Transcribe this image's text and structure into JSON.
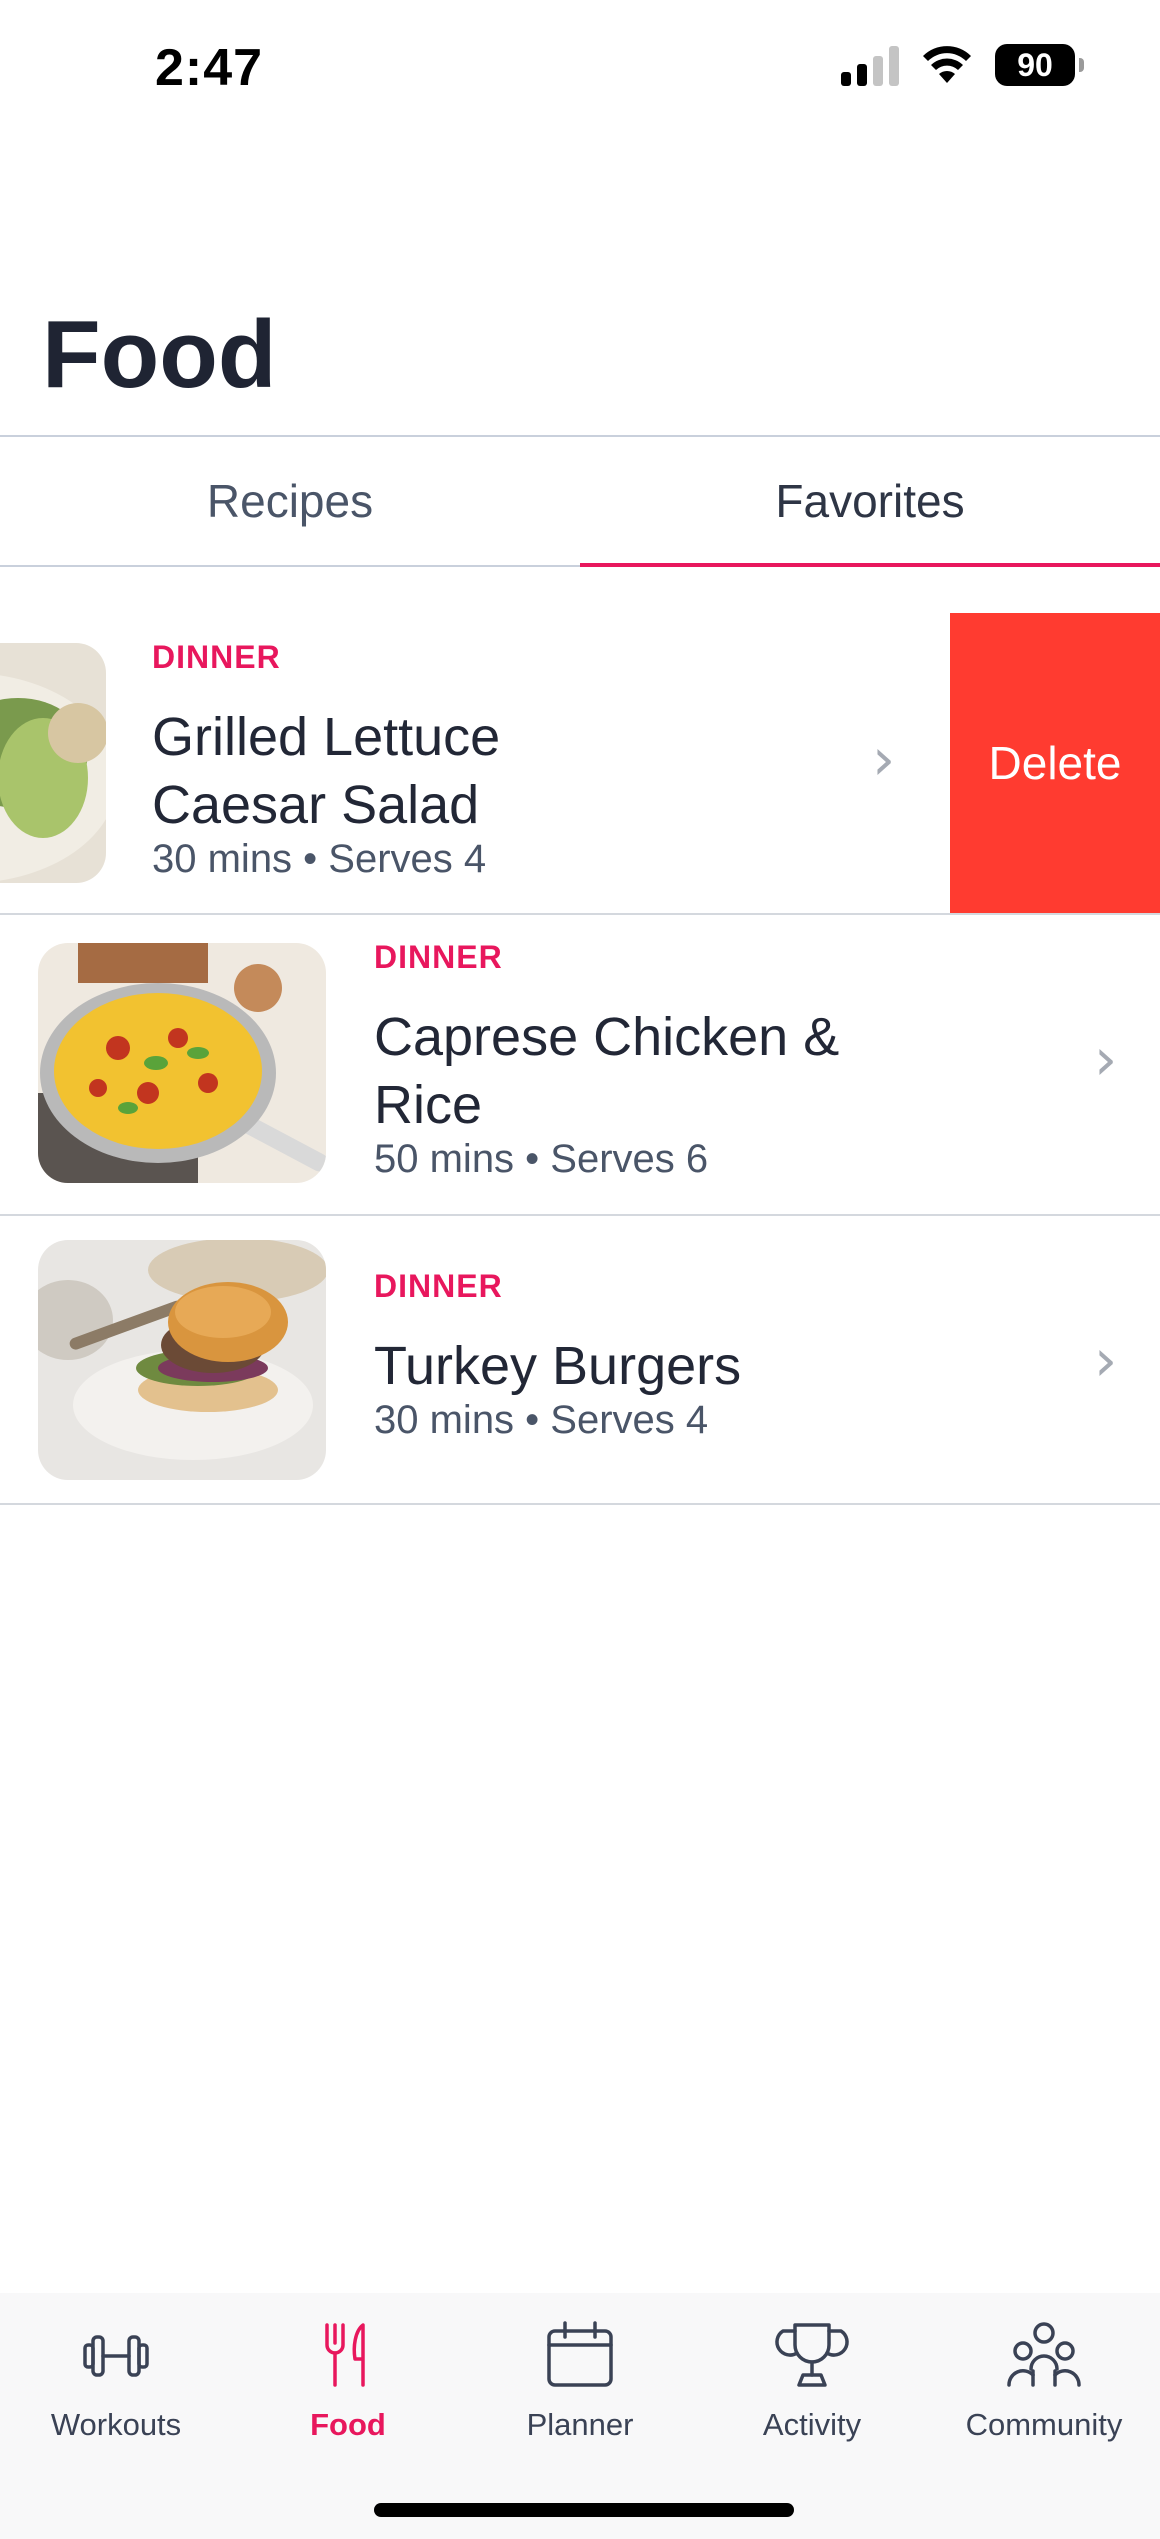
{
  "status_bar": {
    "time": "2:47",
    "battery": "90"
  },
  "page": {
    "title": "Food"
  },
  "tabs": [
    {
      "label": "Recipes",
      "active": false
    },
    {
      "label": "Favorites",
      "active": true
    }
  ],
  "recipes": [
    {
      "category": "DINNER",
      "name": "Grilled Lettuce Caesar Salad",
      "meta": "30 mins • Serves 4"
    },
    {
      "category": "DINNER",
      "name": "Caprese Chicken & Rice",
      "meta": "50 mins • Serves 6"
    },
    {
      "category": "DINNER",
      "name": "Turkey Burgers",
      "meta": "30 mins • Serves 4"
    }
  ],
  "swipe_action": {
    "delete_label": "Delete"
  },
  "bottom_nav": [
    {
      "label": "Workouts",
      "icon": "dumbbell-icon",
      "active": false
    },
    {
      "label": "Food",
      "icon": "fork-knife-icon",
      "active": true
    },
    {
      "label": "Planner",
      "icon": "calendar-icon",
      "active": false
    },
    {
      "label": "Activity",
      "icon": "trophy-icon",
      "active": false
    },
    {
      "label": "Community",
      "icon": "community-icon",
      "active": false
    }
  ],
  "colors": {
    "accent": "#e8175d",
    "delete": "#ff3b30",
    "text": "#222736"
  }
}
